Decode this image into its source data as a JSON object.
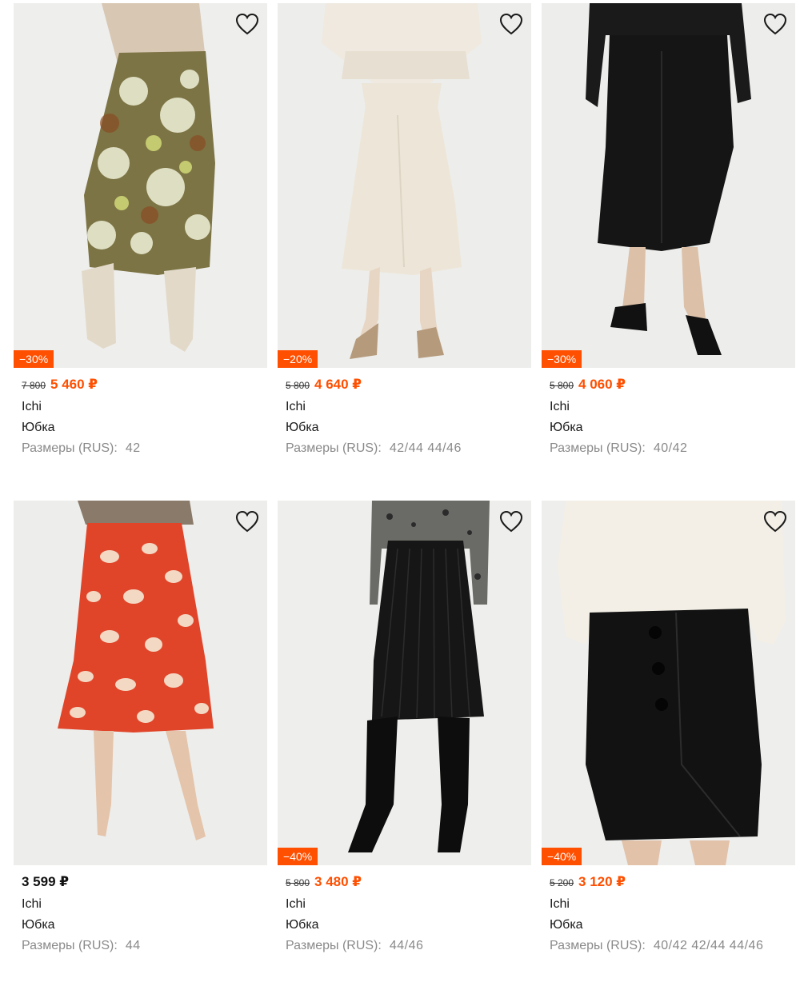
{
  "products": [
    {
      "discount": "−30%",
      "old_price": "7 800",
      "price": "5 460 ₽",
      "brand": "Ichi",
      "type": "Юбка",
      "sizes_label": "Размеры (RUS):",
      "sizes": "42"
    },
    {
      "discount": "−20%",
      "old_price": "5 800",
      "price": "4 640 ₽",
      "brand": "Ichi",
      "type": "Юбка",
      "sizes_label": "Размеры (RUS):",
      "sizes": "42/44 44/46"
    },
    {
      "discount": "−30%",
      "old_price": "5 800",
      "price": "4 060 ₽",
      "brand": "Ichi",
      "type": "Юбка",
      "sizes_label": "Размеры (RUS):",
      "sizes": "40/42"
    },
    {
      "discount": "",
      "old_price": "",
      "price": "3 599 ₽",
      "brand": "Ichi",
      "type": "Юбка",
      "sizes_label": "Размеры (RUS):",
      "sizes": "44"
    },
    {
      "discount": "−40%",
      "old_price": "5 800",
      "price": "3 480 ₽",
      "brand": "Ichi",
      "type": "Юбка",
      "sizes_label": "Размеры (RUS):",
      "sizes": "44/46"
    },
    {
      "discount": "−40%",
      "old_price": "5 200",
      "price": "3 120 ₽",
      "brand": "Ichi",
      "type": "Юбка",
      "sizes_label": "Размеры (RUS):",
      "sizes": "40/42 42/44 44/46"
    }
  ],
  "icons": {
    "favorite": "heart-outline-icon"
  },
  "colors": {
    "accent": "#ff4f00",
    "muted": "#8a8a8a"
  }
}
